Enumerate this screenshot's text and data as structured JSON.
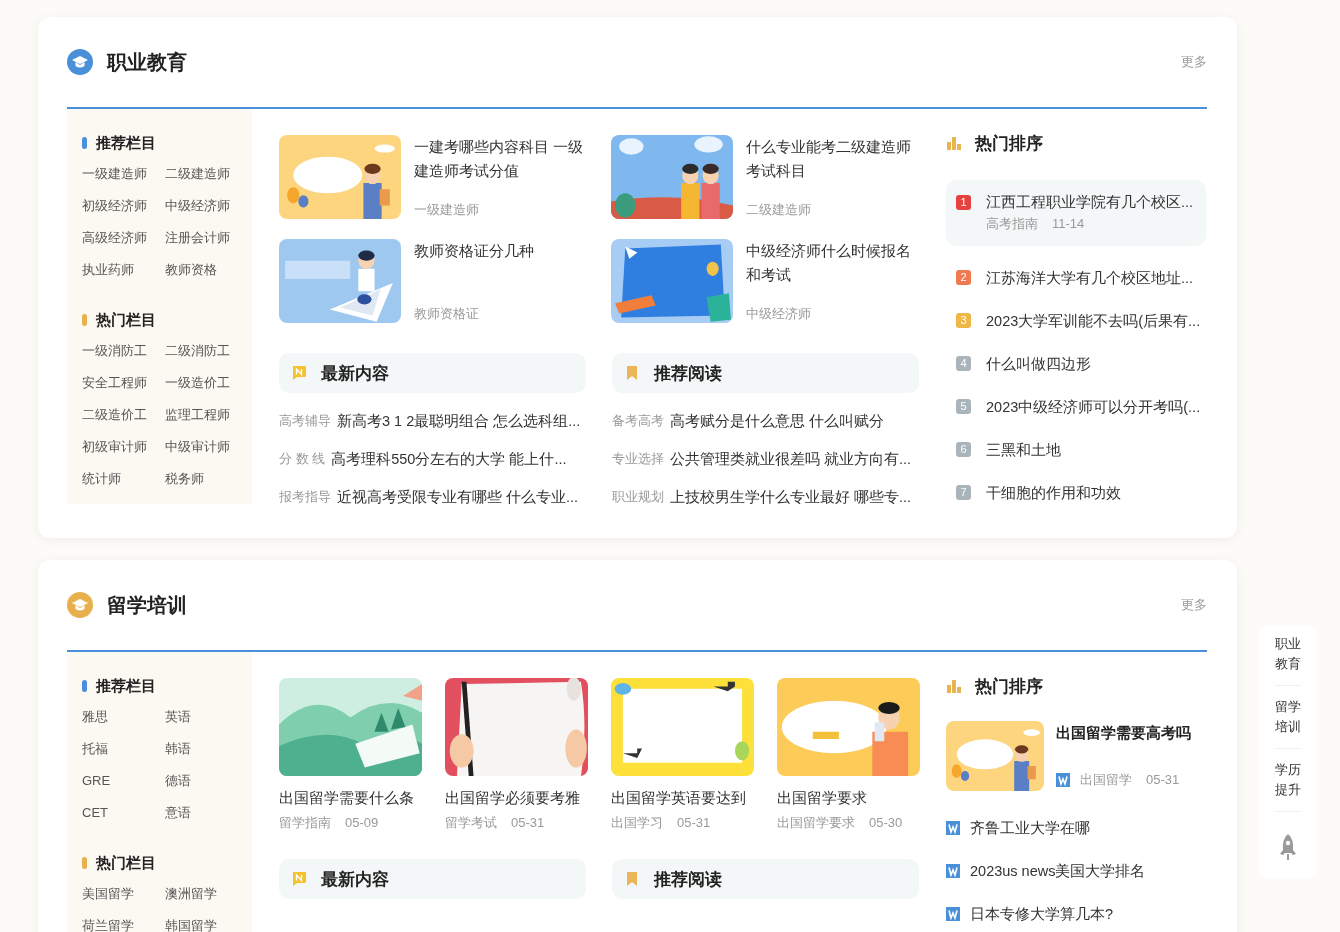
{
  "sections": [
    {
      "title": "职业教育",
      "color": "#4a90d9",
      "more": "更多",
      "sidebar": [
        {
          "kind": "recommend",
          "title": "推荐栏目",
          "links": [
            "一级建造师",
            "二级建造师",
            "初级经济师",
            "中级经济师",
            "高级经济师",
            "注册会计师",
            "执业药师",
            "教师资格"
          ]
        },
        {
          "kind": "hot",
          "title": "热门栏目",
          "links": [
            "一级消防工",
            "二级消防工",
            "安全工程师",
            "一级造价工",
            "二级造价工",
            "监理工程师",
            "初级审计师",
            "中级审计师",
            "统计师",
            "税务师"
          ]
        }
      ],
      "articles": {
        "kind": "rows",
        "items": [
          {
            "title": "一建考哪些内容科目 一级建造师考试分值",
            "tag": "一级建造师"
          },
          {
            "title": "什么专业能考二级建造师考试科目",
            "tag": "二级建造师"
          },
          {
            "title": "教师资格证分几种",
            "tag": "教师资格证"
          },
          {
            "title": "中级经济师什么时候报名和考试",
            "tag": "中级经济师"
          }
        ]
      },
      "feeds": [
        {
          "kind": "latest",
          "title": "最新内容",
          "rows": [
            {
              "tag": "高考辅导",
              "title": "新高考3 1 2最聪明组合 怎么选科组..."
            },
            {
              "tag": "分 数 线",
              "title": "高考理科550分左右的大学 能上什..."
            },
            {
              "tag": "报考指导",
              "title": "近视高考受限专业有哪些 什么专业..."
            }
          ]
        },
        {
          "kind": "recommended",
          "title": "推荐阅读",
          "rows": [
            {
              "tag": "备考高考",
              "title": "高考赋分是什么意思 什么叫赋分"
            },
            {
              "tag": "专业选择",
              "title": "公共管理类就业很差吗 就业方向有..."
            },
            {
              "tag": "职业规划",
              "title": "上技校男生学什么专业最好 哪些专..."
            }
          ]
        }
      ],
      "ranking": {
        "title": "热门排序",
        "items": [
          {
            "kind": "numbered",
            "rank": "1",
            "color": "#e5413e",
            "title": "江西工程职业学院有几个校区...",
            "expanded": true,
            "tag": "高考指南",
            "date": "11-14"
          },
          {
            "kind": "numbered",
            "rank": "2",
            "color": "#ef7a51",
            "title": "江苏海洋大学有几个校区地址...",
            "expanded": false
          },
          {
            "kind": "numbered",
            "rank": "3",
            "color": "#efb745",
            "title": "2023大学军训能不去吗(后果有...",
            "expanded": false
          },
          {
            "kind": "numbered",
            "rank": "4",
            "color": "#aab5bb",
            "title": "什么叫做四边形",
            "expanded": false
          },
          {
            "kind": "numbered",
            "rank": "5",
            "color": "#aab5bb",
            "title": "2023中级经济师可以分开考吗(...",
            "expanded": false
          },
          {
            "kind": "numbered",
            "rank": "6",
            "color": "#aab5bb",
            "title": "三黑和土地",
            "expanded": false
          },
          {
            "kind": "numbered",
            "rank": "7",
            "color": "#aab5bb",
            "title": "干细胞的作用和功效",
            "expanded": false
          }
        ]
      }
    },
    {
      "title": "留学培训",
      "color": "#e8b04a",
      "more": "更多",
      "sidebar": [
        {
          "kind": "recommend",
          "title": "推荐栏目",
          "links": [
            "雅思",
            "英语",
            "托福",
            "韩语",
            "GRE",
            "德语",
            "CET",
            "意语"
          ]
        },
        {
          "kind": "hot",
          "title": "热门栏目",
          "links": [
            "美国留学",
            "澳洲留学",
            "荷兰留学",
            "韩国留学"
          ]
        }
      ],
      "articles": {
        "kind": "cards",
        "items": [
          {
            "title": "出国留学需要什么条",
            "tag": "留学指南",
            "date": "05-09"
          },
          {
            "title": "出国留学必须要考雅",
            "tag": "留学考试",
            "date": "05-31"
          },
          {
            "title": "出国留学英语要达到",
            "tag": "出国学习",
            "date": "05-31"
          },
          {
            "title": "出国留学要求",
            "tag": "出国留学要求",
            "date": "05-30"
          }
        ]
      },
      "feeds": [
        {
          "kind": "latest",
          "title": "最新内容"
        },
        {
          "kind": "recommended",
          "title": "推荐阅读"
        }
      ],
      "ranking": {
        "title": "热门排序",
        "items": [
          {
            "kind": "featured",
            "title": "出国留学需要高考吗",
            "tag": "出国留学",
            "date": "05-31"
          },
          {
            "kind": "link",
            "title": "齐鲁工业大学在哪"
          },
          {
            "kind": "link",
            "title": "2023us news美国大学排名"
          },
          {
            "kind": "link",
            "title": "日本专修大学算几本?"
          }
        ]
      }
    }
  ],
  "side_nav": {
    "items": [
      "职业教育",
      "留学培训",
      "学历提升"
    ]
  }
}
